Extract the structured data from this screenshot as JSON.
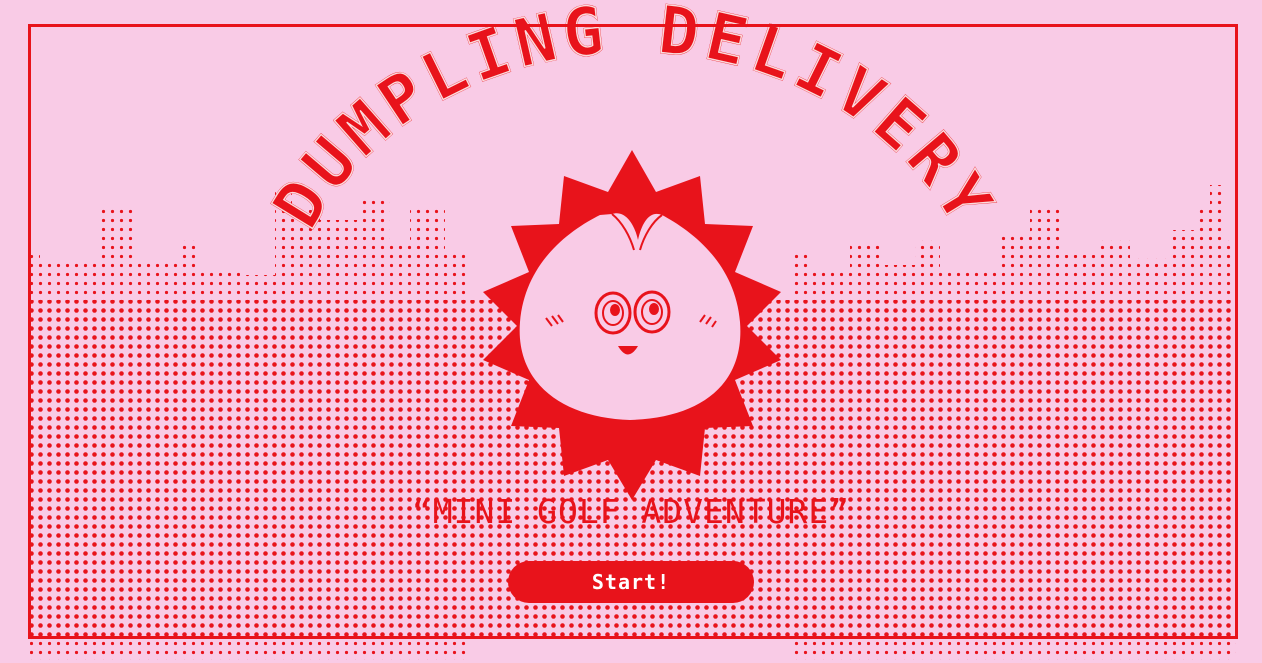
{
  "game": {
    "title": "DUMPLING DELIVERY",
    "subtitle": "“MINI GOLF ADVENTURE”",
    "start_label": "Start!"
  },
  "colors": {
    "background": "#f9cbe6",
    "accent": "#e8131b",
    "dumpling": "#f9cbe6",
    "button_text": "#ffffff"
  },
  "icons": {
    "mascot": "smiling-dumpling-icon",
    "burst": "sunburst-badge",
    "backdrop": "halftone-city-skyline"
  }
}
